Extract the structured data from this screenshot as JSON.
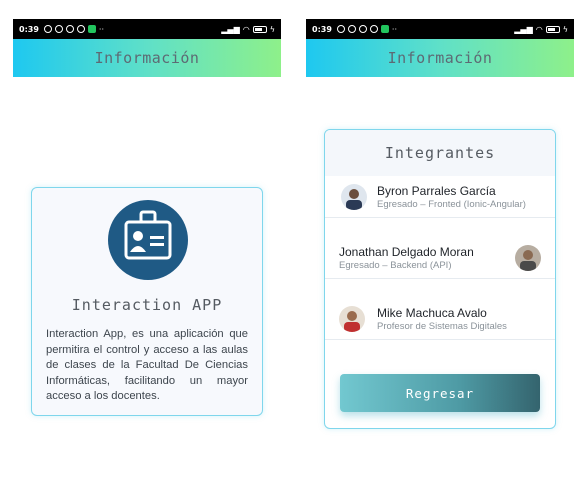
{
  "status_bar": {
    "time": "0:39",
    "battery": "83"
  },
  "screens": [
    {
      "app_bar": {
        "title": "Información"
      },
      "card": {
        "icon": "id-badge-icon",
        "title": "Interaction APP",
        "description": "Interaction App, es una aplicación que permitira el control y acceso a las aulas de clases de la Facultad De Ciencias Informáticas, facilitando un mayor acceso a los docentes."
      }
    },
    {
      "app_bar": {
        "title": "Información"
      },
      "card": {
        "title": "Integrantes",
        "members": [
          {
            "name": "Byron Parrales García",
            "role": "Egresado – Fronted (Ionic-Angular)",
            "avatar": "avatar-icon"
          },
          {
            "name": "Jonathan Delgado Moran",
            "role": "Egresado – Backend (API)",
            "avatar": "avatar-icon"
          },
          {
            "name": "Mike Machuca Avalo",
            "role": "Profesor de Sistemas Digitales",
            "avatar": "avatar-icon"
          }
        ],
        "back_label": "Regresar"
      }
    }
  ],
  "colors": {
    "appbar_start": "#1ec8f0",
    "appbar_end": "#8ef08a",
    "card_border": "#7fd6ec",
    "badge_blue": "#1f5a85",
    "button_start": "#72c8d0",
    "button_end": "#34646e"
  }
}
